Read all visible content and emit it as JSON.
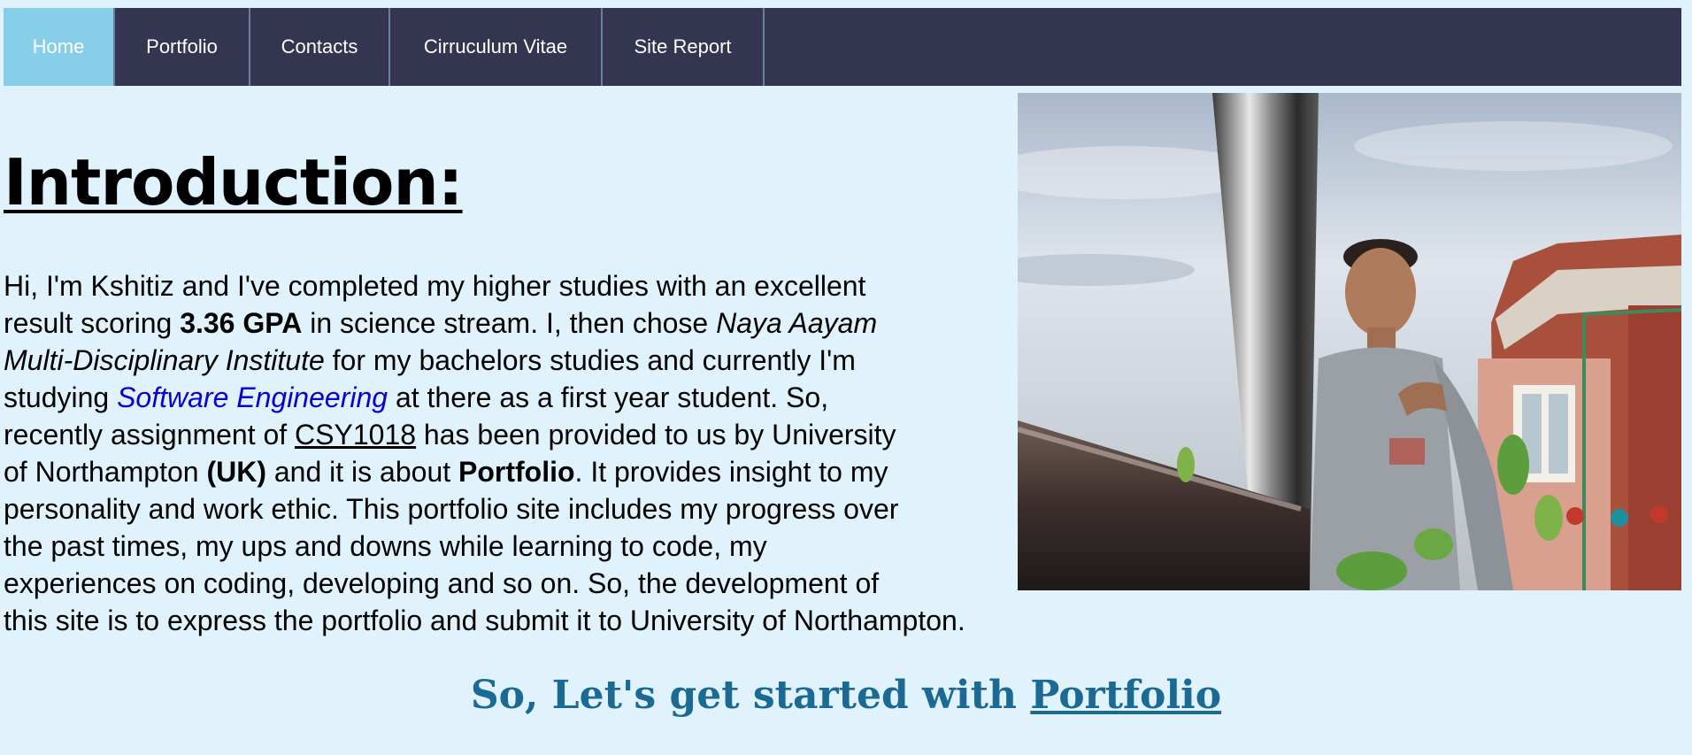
{
  "nav": {
    "items": [
      {
        "label": "Home",
        "active": true
      },
      {
        "label": "Portfolio",
        "active": false
      },
      {
        "label": "Contacts",
        "active": false
      },
      {
        "label": "Cirruculum Vitae",
        "active": false
      },
      {
        "label": "Site Report",
        "active": false
      }
    ]
  },
  "main": {
    "heading": "Introduction:",
    "intro": {
      "segments": [
        "Hi, I'm Kshitiz and I've completed my higher studies with an excellent",
        "result scoring ",
        "3.36 GPA",
        " in science stream. I, then chose ",
        "Naya Aayam",
        "Multi-Disciplinary Institute",
        " for my bachelors studies and currently I'm",
        "studying ",
        "Software Engineering",
        " at there as a first year student. So,",
        "recently assignment of ",
        "CSY1018",
        " has been provided to us by University",
        "of Northampton ",
        "(UK)",
        " and it is about ",
        "Portfolio",
        ". It provides insight to my",
        "personality and work ethic. This portfolio site includes my progress over",
        "the past times, my ups and downs while learning to code, my",
        "experiences on coding, developing and so on. So, the development of",
        "this site is to express the portfolio and submit it to University of Northampton."
      ]
    },
    "cta": {
      "prefix": "So, Let's get started with ",
      "link": "Portfolio"
    }
  },
  "colors": {
    "background": "#e0f2fb",
    "nav_background": "#333551",
    "nav_active": "#87ceeb",
    "cta_text": "#1b6a94",
    "highlight_link": "#0a00d2"
  }
}
